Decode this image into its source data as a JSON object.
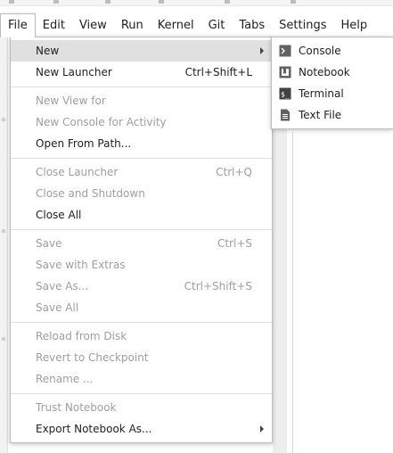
{
  "menubar": {
    "items": [
      {
        "label": "File"
      },
      {
        "label": "Edit"
      },
      {
        "label": "View"
      },
      {
        "label": "Run"
      },
      {
        "label": "Kernel"
      },
      {
        "label": "Git"
      },
      {
        "label": "Tabs"
      },
      {
        "label": "Settings"
      },
      {
        "label": "Help"
      }
    ]
  },
  "file_menu": {
    "new": {
      "label": "New"
    },
    "new_launcher": {
      "label": "New Launcher",
      "shortcut": "Ctrl+Shift+L"
    },
    "new_view_for": {
      "label": "New View for"
    },
    "new_console_for_activity": {
      "label": "New Console for Activity"
    },
    "open_from_path": {
      "label": "Open From Path..."
    },
    "close_launcher": {
      "label": "Close Launcher",
      "shortcut": "Ctrl+Q"
    },
    "close_and_shutdown": {
      "label": "Close and Shutdown"
    },
    "close_all": {
      "label": "Close All"
    },
    "save": {
      "label": "Save",
      "shortcut": "Ctrl+S"
    },
    "save_with_extras": {
      "label": "Save with Extras"
    },
    "save_as": {
      "label": "Save As...",
      "shortcut": "Ctrl+Shift+S"
    },
    "save_all": {
      "label": "Save All"
    },
    "reload_from_disk": {
      "label": "Reload from Disk"
    },
    "revert_to_checkpoint": {
      "label": "Revert to Checkpoint"
    },
    "rename": {
      "label": "Rename ..."
    },
    "trust_notebook": {
      "label": "Trust Notebook"
    },
    "export_notebook_as": {
      "label": "Export Notebook As..."
    }
  },
  "new_submenu": {
    "items": [
      {
        "label": "Console",
        "icon": "console-icon"
      },
      {
        "label": "Notebook",
        "icon": "notebook-icon"
      },
      {
        "label": "Terminal",
        "icon": "terminal-icon"
      },
      {
        "label": "Text File",
        "icon": "text-file-icon"
      }
    ]
  },
  "colors": {
    "menu_hover": "#e0e0e0",
    "disabled_text": "#9e9e9e",
    "text": "#212121",
    "icon": "#616161"
  }
}
